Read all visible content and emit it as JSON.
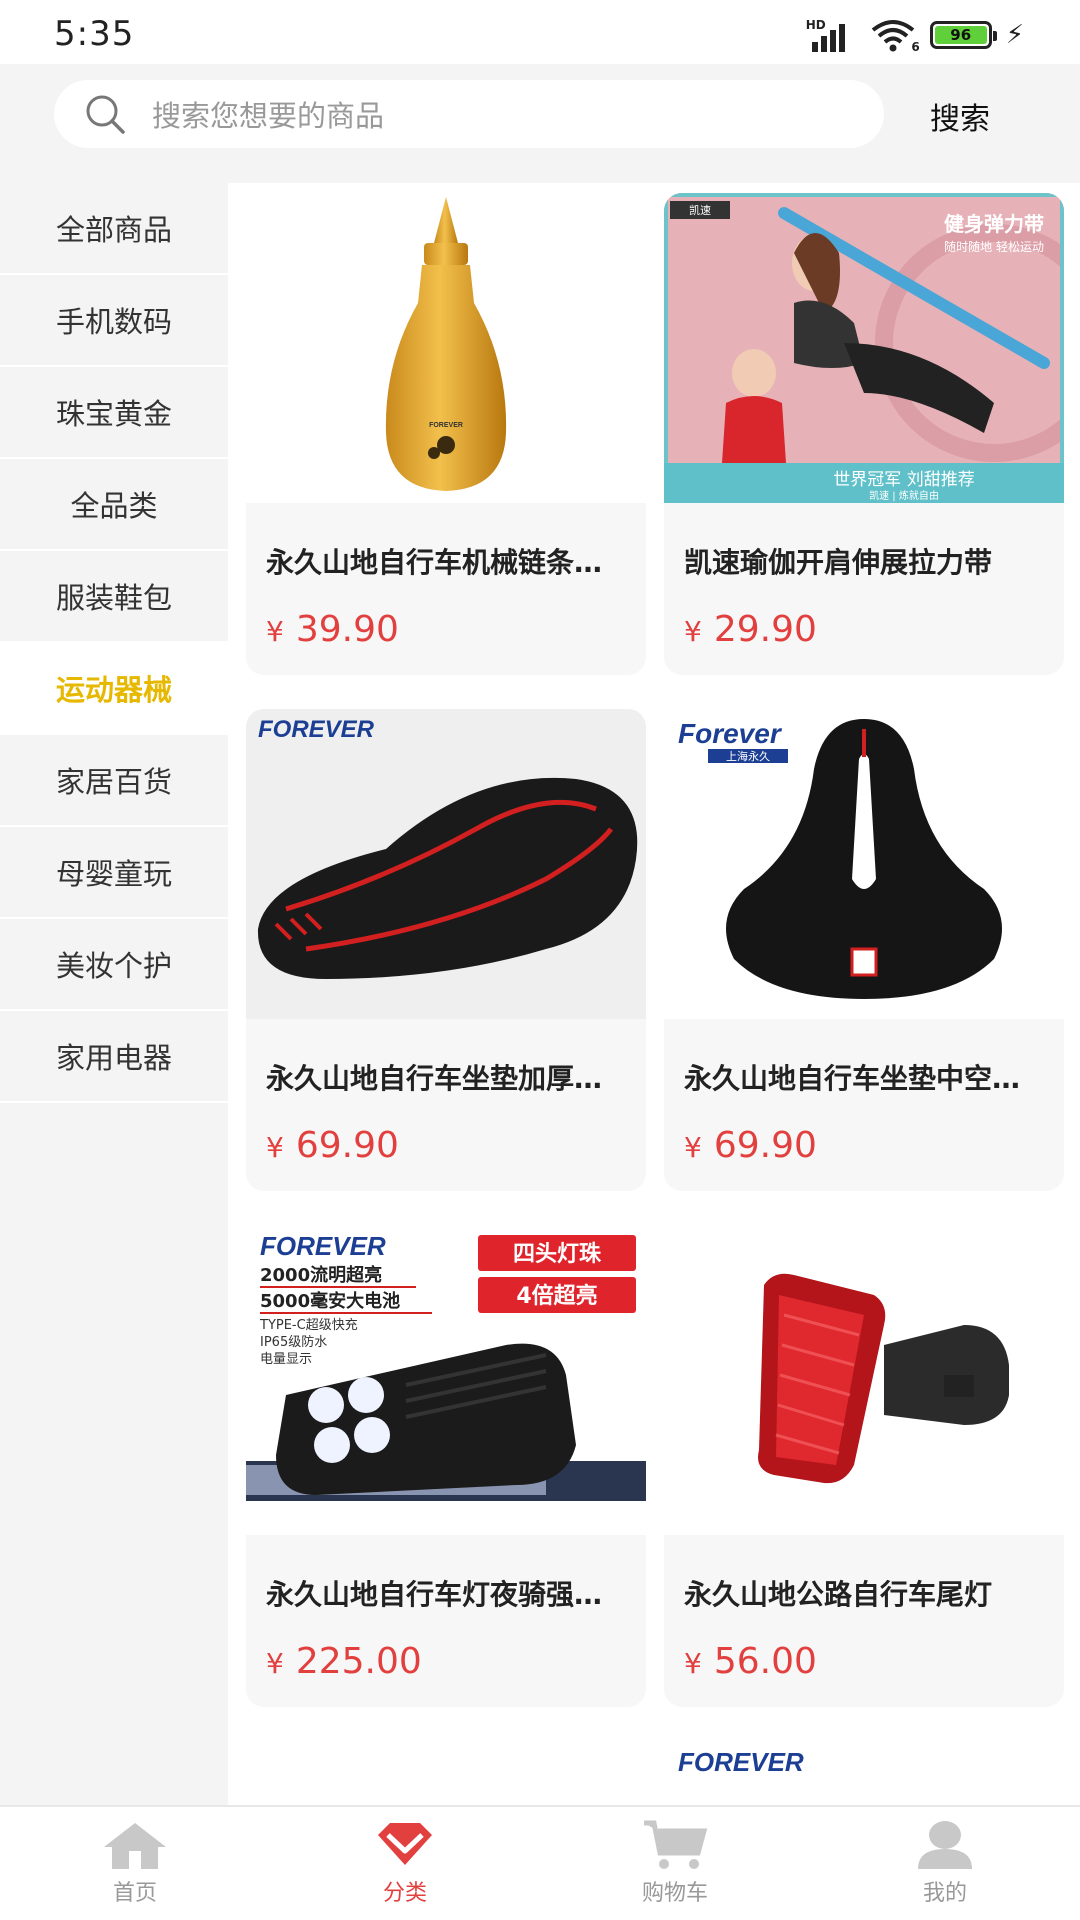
{
  "status_bar": {
    "time": "5:35",
    "network_label": "HD",
    "wifi_label": "6",
    "battery_level": "96"
  },
  "search": {
    "placeholder": "搜索您想要的商品",
    "button_label": "搜索"
  },
  "sidebar": {
    "items": [
      {
        "label": "全部商品",
        "active": false
      },
      {
        "label": "手机数码",
        "active": false
      },
      {
        "label": "珠宝黄金",
        "active": false
      },
      {
        "label": "全品类",
        "active": false
      },
      {
        "label": "服装鞋包",
        "active": false
      },
      {
        "label": "运动器械",
        "active": true
      },
      {
        "label": "家居百货",
        "active": false
      },
      {
        "label": "母婴童玩",
        "active": false
      },
      {
        "label": "美妆个护",
        "active": false
      },
      {
        "label": "家用电器",
        "active": false
      }
    ]
  },
  "products": [
    {
      "title": "永久山地自行车机械链条润滑油",
      "currency": "¥",
      "price": "39.90",
      "image": {
        "brand": "FOREVER"
      }
    },
    {
      "title": "凯速瑜伽开肩伸展拉力带",
      "currency": "¥",
      "price": "29.90",
      "image": {
        "brand": "凯速",
        "headline": "健身弹力带",
        "subline": "随时随地 轻松运动",
        "banner": "世界冠军 刘甜推荐",
        "banner_sub": "凯速 | 炼就自由"
      }
    },
    {
      "title": "永久山地自行车坐垫加厚舒适",
      "currency": "¥",
      "price": "69.90",
      "image": {
        "brand": "FOREVER"
      }
    },
    {
      "title": "永久山地自行车坐垫中空透气",
      "currency": "¥",
      "price": "69.90",
      "image": {
        "brand": "Forever",
        "brand_sub": "上海永久"
      }
    },
    {
      "title": "永久山地自行车灯夜骑强光手电",
      "currency": "¥",
      "price": "225.00",
      "image": {
        "brand": "FOREVER",
        "line1": "2000流明超亮",
        "line2": "5000毫安大电池",
        "line3": "TYPE-C超级快充",
        "line4": "IP65级防水",
        "line5": "电量显示",
        "badge1": "四头灯珠",
        "badge2": "4倍超亮"
      }
    },
    {
      "title": "永久山地公路自行车尾灯",
      "currency": "¥",
      "price": "56.00",
      "image": {}
    }
  ],
  "partial_products": [
    {
      "brand": ""
    },
    {
      "brand": "FOREVER"
    }
  ],
  "bottom_nav": {
    "items": [
      {
        "label": "首页",
        "icon": "home-icon",
        "active": false
      },
      {
        "label": "分类",
        "icon": "category-icon",
        "active": true
      },
      {
        "label": "购物车",
        "icon": "cart-icon",
        "active": false
      },
      {
        "label": "我的",
        "icon": "profile-icon",
        "active": false
      }
    ]
  },
  "colors": {
    "accent_active_category": "#e6b800",
    "price": "#e2403f",
    "nav_active": "#e2403f"
  }
}
